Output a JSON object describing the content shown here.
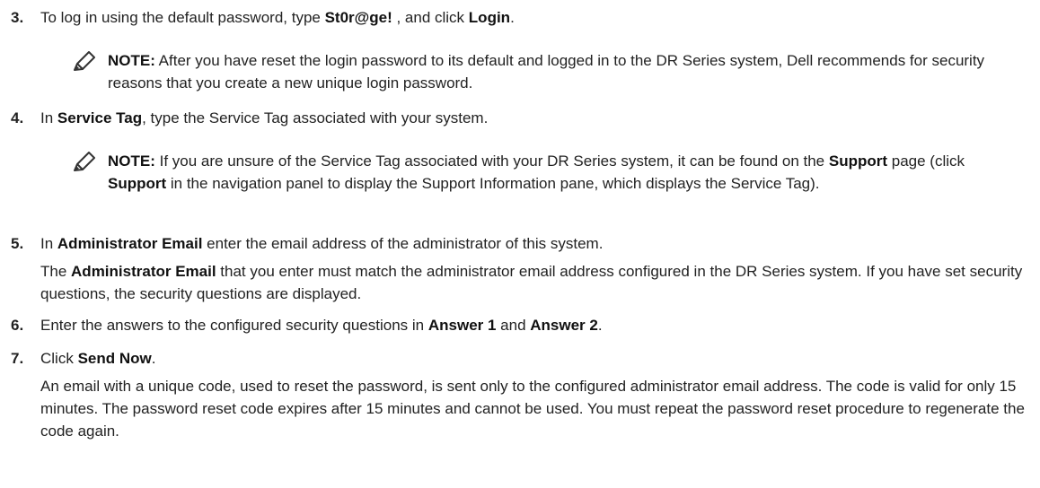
{
  "steps": {
    "s3": {
      "num": "3.",
      "a": "To log in using the default password, type ",
      "b": "St0r@ge!",
      "c": " , and click ",
      "d": "Login",
      "e": "."
    },
    "s4": {
      "num": "4.",
      "a": "In ",
      "b": "Service Tag",
      "c": ", type the Service Tag associated with your system."
    },
    "s5": {
      "num": "5.",
      "a": "In ",
      "b": "Administrator Email",
      "c": " enter the email address of the administrator of this system."
    },
    "s6": {
      "num": "6.",
      "a": "Enter the answers to the configured security questions in ",
      "b": "Answer 1",
      "c": " and ",
      "d": "Answer 2",
      "e": "."
    },
    "s7": {
      "num": "7.",
      "a": "Click ",
      "b": "Send Now",
      "c": "."
    }
  },
  "notes": {
    "n1": {
      "label": "NOTE:",
      "text": " After you have reset the login password to its default and logged in to the DR Series system, Dell recommends for security reasons that you create a new unique login password."
    },
    "n2": {
      "label": "NOTE:",
      "a": " If you are unsure of the Service Tag associated with your DR Series system, it can be found on the ",
      "b": "Support",
      "c": " page (click ",
      "d": "Support",
      "e": " in the navigation panel to display the Support Information pane, which displays the Service Tag)."
    }
  },
  "paras": {
    "p5": {
      "a": "The ",
      "b": "Administrator Email",
      "c": " that you enter must match the administrator email address configured in the DR Series system. If you have set security questions, the security questions are displayed."
    },
    "p7": {
      "text": "An email with a unique code, used to reset the password, is sent only to the configured administrator email address. The code is valid for only 15 minutes. The password reset code expires after 15 minutes and cannot be used. You must repeat the password reset procedure to regenerate the code again."
    }
  },
  "colors": {
    "text": "#222222",
    "icon": "#333333"
  }
}
